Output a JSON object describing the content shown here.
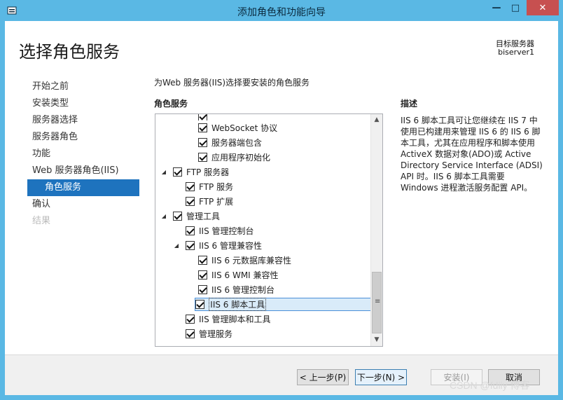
{
  "window": {
    "title": "添加角色和功能向导",
    "min_glyph": "—",
    "max_glyph": "□",
    "close_glyph": "✕"
  },
  "header": {
    "page_title": "选择角色服务",
    "dest_label": "目标服务器",
    "dest_server": "biserver1"
  },
  "nav": {
    "items": [
      {
        "label": "开始之前",
        "state": "normal"
      },
      {
        "label": "安装类型",
        "state": "normal"
      },
      {
        "label": "服务器选择",
        "state": "normal"
      },
      {
        "label": "服务器角色",
        "state": "normal"
      },
      {
        "label": "功能",
        "state": "normal"
      },
      {
        "label": "Web 服务器角色(IIS)",
        "state": "normal"
      },
      {
        "label": "角色服务",
        "state": "active"
      },
      {
        "label": "确认",
        "state": "normal"
      },
      {
        "label": "结果",
        "state": "disabled"
      }
    ]
  },
  "content": {
    "instruction": "为Web 服务器(IIS)选择要安装的角色服务",
    "section_label": "角色服务",
    "tree": [
      {
        "label": "",
        "checked": true,
        "indent": 3,
        "expander": "",
        "cut": true
      },
      {
        "label": "WebSocket 协议",
        "checked": true,
        "indent": 3,
        "expander": ""
      },
      {
        "label": "服务器端包含",
        "checked": true,
        "indent": 3,
        "expander": ""
      },
      {
        "label": "应用程序初始化",
        "checked": true,
        "indent": 3,
        "expander": ""
      },
      {
        "label": "FTP 服务器",
        "checked": true,
        "indent": 1,
        "expander": "◢"
      },
      {
        "label": "FTP 服务",
        "checked": true,
        "indent": 2,
        "expander": ""
      },
      {
        "label": "FTP 扩展",
        "checked": true,
        "indent": 2,
        "expander": ""
      },
      {
        "label": "管理工具",
        "checked": true,
        "indent": 1,
        "expander": "◢"
      },
      {
        "label": "IIS 管理控制台",
        "checked": true,
        "indent": 2,
        "expander": ""
      },
      {
        "label": "IIS 6 管理兼容性",
        "checked": true,
        "indent": 2,
        "expander": "◢"
      },
      {
        "label": "IIS 6 元数据库兼容性",
        "checked": true,
        "indent": 3,
        "expander": ""
      },
      {
        "label": "IIS 6 WMI 兼容性",
        "checked": true,
        "indent": 3,
        "expander": ""
      },
      {
        "label": "IIS 6 管理控制台",
        "checked": true,
        "indent": 3,
        "expander": ""
      },
      {
        "label": "IIS 6 脚本工具",
        "checked": true,
        "indent": 3,
        "expander": "",
        "selected": true
      },
      {
        "label": "IIS 管理脚本和工具",
        "checked": true,
        "indent": 2,
        "expander": ""
      },
      {
        "label": "管理服务",
        "checked": true,
        "indent": 2,
        "expander": ""
      }
    ],
    "scroll_up_glyph": "▲",
    "scroll_down_glyph": "▼",
    "scroll_grip_glyph": "≡",
    "description_label": "描述",
    "description_text": "IIS 6 脚本工具可让您继续在 IIS 7 中使用已构建用来管理 IIS 6 的 IIS 6 脚本工具，尤其在应用程序和脚本使用 ActiveX 数据对象(ADO)或 Active Directory Service Interface (ADSI) API 时。IIS 6 脚本工具需要 Windows 进程激活服务配置 API。"
  },
  "footer": {
    "prev_label": "< 上一步(P)",
    "next_label": "下一步(N) >",
    "install_label": "安装(I)",
    "cancel_label": "取消"
  },
  "watermark": "CSDN @fdiiy 博客"
}
